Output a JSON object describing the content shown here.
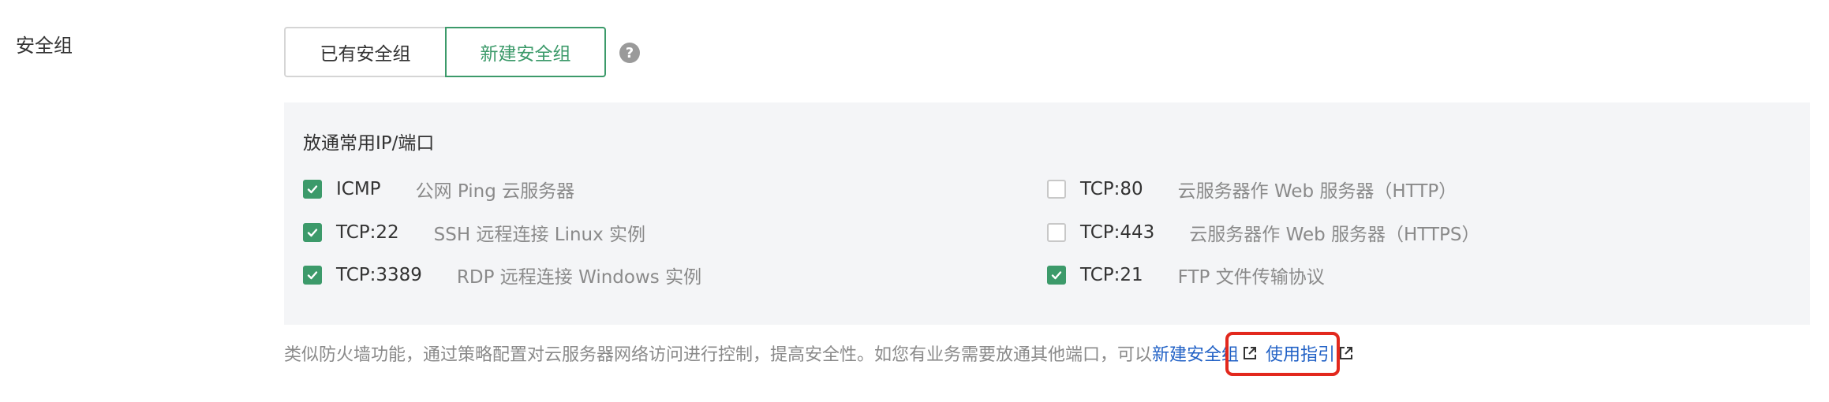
{
  "field": {
    "label": "安全组"
  },
  "toggle": {
    "existing_label": "已有安全组",
    "new_label": "新建安全组",
    "selected": "新建安全组"
  },
  "help": {
    "glyph": "?"
  },
  "panel": {
    "title": "放通常用IP/端口",
    "rules": [
      {
        "port": "ICMP",
        "desc": "公网 Ping 云服务器",
        "checked": true
      },
      {
        "port": "TCP:22",
        "desc": "SSH 远程连接 Linux 实例",
        "checked": true
      },
      {
        "port": "TCP:3389",
        "desc": "RDP 远程连接 Windows 实例",
        "checked": true
      },
      {
        "port": "TCP:80",
        "desc": "云服务器作 Web 服务器（HTTP）",
        "checked": false
      },
      {
        "port": "TCP:443",
        "desc": "云服务器作 Web 服务器（HTTPS）",
        "checked": false
      },
      {
        "port": "TCP:21",
        "desc": "FTP 文件传输协议",
        "checked": true
      }
    ]
  },
  "footer": {
    "text": "类似防火墙功能，通过策略配置对云服务器网络访问进行控制，提高安全性。如您有业务需要放通其他端口，可以",
    "link_new": "新建安全组",
    "link_guide": "使用指引"
  },
  "colors": {
    "accent_green": "#3c9a6a",
    "link_blue": "#2262c6",
    "highlight_red": "#e2281d",
    "panel_bg": "#f4f5f7"
  }
}
